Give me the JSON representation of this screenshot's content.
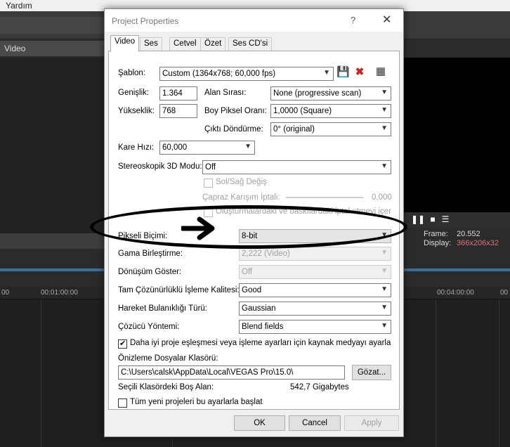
{
  "app": {
    "menu": {
      "help": "Yardım"
    },
    "video_tab": "Video",
    "info": {
      "frame_label": "Frame:",
      "frame_value": "20.552",
      "display_label": "Display:",
      "display_value": "366x206x32"
    },
    "ruler": [
      "00",
      "00:01:00:00",
      "00:04:00:00",
      "00"
    ]
  },
  "dialog": {
    "title": "Project Properties",
    "help": "?",
    "close": "✕",
    "tabs": [
      "Video",
      "Ses",
      "Cetvel",
      "Özet",
      "Ses CD'si"
    ],
    "template": {
      "label": "Şablon:",
      "value": "Custom (1364x768; 60,000 fps)"
    },
    "width": {
      "label": "Genişlik:",
      "value": "1.364"
    },
    "height": {
      "label": "Yükseklik:",
      "value": "768"
    },
    "field_order": {
      "label": "Alan Sırası:",
      "value": "None (progressive scan)"
    },
    "pixel_aspect": {
      "label": "Boy Piksel Oranı:",
      "value": "1,0000 (Square)"
    },
    "output_rotation": {
      "label": "Çıktı Döndürme:",
      "value": "0° (original)"
    },
    "frame_rate": {
      "label": "Kare Hızı:",
      "value": "60,000"
    },
    "stereo_mode": {
      "label": "Stereoskopik 3D Modu:",
      "value": "Off"
    },
    "swap_lr": {
      "label": "Sol/Sağ Değiş"
    },
    "crosstalk": {
      "label": "Çapraz Karışım İptali:",
      "value": "0,000"
    },
    "crosstalk_note": {
      "label": "Oluşturmalardaki ve baskılardaki iptal etmeyi içer"
    },
    "pixel_format": {
      "label": "Pikseli Biçimi:",
      "value": "8-bit"
    },
    "compositing_gamma": {
      "label": "Gama Birleştirme:",
      "value": "2,222 (Video)"
    },
    "view_transform": {
      "label": "Dönüşüm Göster:",
      "value": "Off"
    },
    "render_quality": {
      "label": "Tam Çözünürlüklü İşleme Kalitesi:",
      "value": "Good"
    },
    "motion_blur": {
      "label": "Hareket Bulanıklığı Türü:",
      "value": "Gaussian"
    },
    "deinterlace": {
      "label": "Çözücü Yöntemi:",
      "value": "Blend fields"
    },
    "adjust_media": {
      "label": "Daha iyi proje eşleşmesi veya işleme ayarları için kaynak medyayı ayarla",
      "checked": true
    },
    "prerender_folder": {
      "label": "Önizleme Dosyalar Klasörü:",
      "value": "C:\\Users\\calsk\\AppData\\Local\\VEGAS Pro\\15.0\\"
    },
    "browse": "Gözat...",
    "free_space": {
      "label": "Seçili Klasördeki Boş Alan:",
      "value": "542,7 Gigabytes"
    },
    "start_all_new": {
      "label": "Tüm yeni projeleri bu ayarlarla başlat",
      "checked": false
    },
    "buttons": {
      "ok": "OK",
      "cancel": "Cancel",
      "apply": "Apply"
    }
  },
  "colors": {
    "display_value": "#e0707a",
    "annotation": "#000000"
  }
}
